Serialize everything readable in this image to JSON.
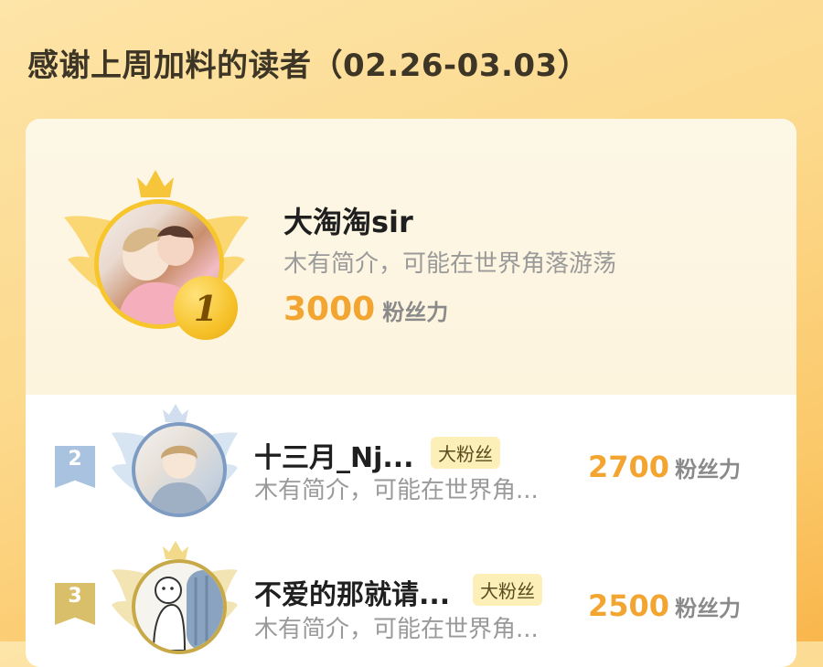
{
  "page": {
    "title": "感谢上周加料的读者（02.26-03.03）"
  },
  "colors": {
    "accent_orange": "#f2a530",
    "gold": "#f6c22a",
    "silver_blue": "#a9c2df",
    "bronze": "#d9bf6a",
    "tag_bg": "#fdefb8"
  },
  "leaderboard": {
    "first": {
      "rank": "1",
      "name": "大淘淘sir",
      "bio": "木有简介，可能在世界角落游荡",
      "score": "3000",
      "score_unit": "粉丝力",
      "icons": [
        "crown-icon",
        "wings-icon",
        "rank-medal-icon"
      ]
    },
    "rows": [
      {
        "rank": "2",
        "name": "十三月_Nj...",
        "tag": "大粉丝",
        "bio": "木有简介，可能在世界角...",
        "score": "2700",
        "score_unit": "粉丝力"
      },
      {
        "rank": "3",
        "name": "不爱的那就请...",
        "tag": "大粉丝",
        "bio": "木有简介，可能在世界角...",
        "score": "2500",
        "score_unit": "粉丝力"
      }
    ]
  }
}
